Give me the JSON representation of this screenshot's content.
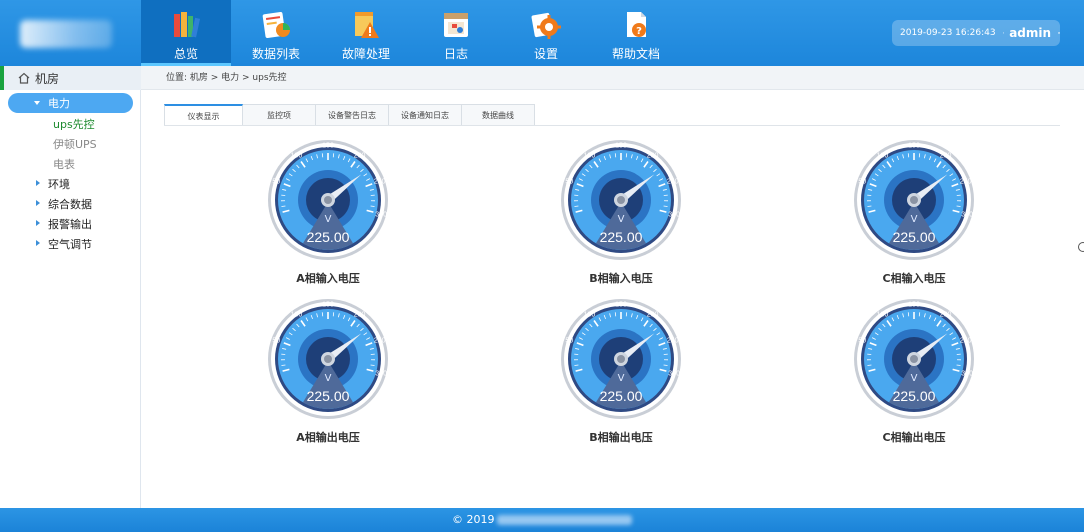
{
  "header": {
    "nav": [
      {
        "label": "总览",
        "icon": "books-icon",
        "active": true
      },
      {
        "label": "数据列表",
        "icon": "chart-list-icon",
        "active": false
      },
      {
        "label": "故障处理",
        "icon": "warning-icon",
        "active": false
      },
      {
        "label": "日志",
        "icon": "calendar-log-icon",
        "active": false
      },
      {
        "label": "设置",
        "icon": "gear-icon",
        "active": false
      },
      {
        "label": "帮助文档",
        "icon": "help-document-icon",
        "active": false
      }
    ],
    "datetime": "2019-09-23  16:26:43",
    "username": "admin"
  },
  "sidebar": {
    "root_label": "机房",
    "group_label": "电力",
    "sub_items": [
      {
        "label": "ups先控",
        "active": true
      },
      {
        "label": "伊顿UPS",
        "active": false
      },
      {
        "label": "电表",
        "active": false
      }
    ],
    "items": [
      "环境",
      "综合数据",
      "报警输出",
      "空气调节"
    ]
  },
  "breadcrumb": "位置:  机房 > 电力 > ups先控",
  "tabs": [
    {
      "label": "仪表显示",
      "active": true
    },
    {
      "label": "监控项",
      "active": false
    },
    {
      "label": "设备警告日志",
      "active": false
    },
    {
      "label": "设备通知日志",
      "active": false
    },
    {
      "label": "数据曲线",
      "active": false
    }
  ],
  "gauge_scale": {
    "min": 0,
    "max": 300,
    "tick_labels": [
      "0",
      "50",
      "100",
      "150",
      "200",
      "250",
      "300"
    ],
    "unit": "V"
  },
  "gauges": [
    {
      "caption": "A相输入电压",
      "value": "225.00"
    },
    {
      "caption": "B相输入电压",
      "value": "225.00"
    },
    {
      "caption": "C相输入电压",
      "value": "225.00"
    },
    {
      "caption": "A相输出电压",
      "value": "225.00"
    },
    {
      "caption": "B相输出电压",
      "value": "225.00"
    },
    {
      "caption": "C相输出电压",
      "value": "225.00"
    }
  ],
  "footer": {
    "copyright": "© 2019"
  },
  "colors": {
    "header_blue": "#1d86db",
    "active_nav": "#0f6fc0",
    "sidebar_active_pill": "#4da8f2",
    "gauge_face": "#4aa8ef",
    "gauge_bezel": "#2f4a84"
  }
}
